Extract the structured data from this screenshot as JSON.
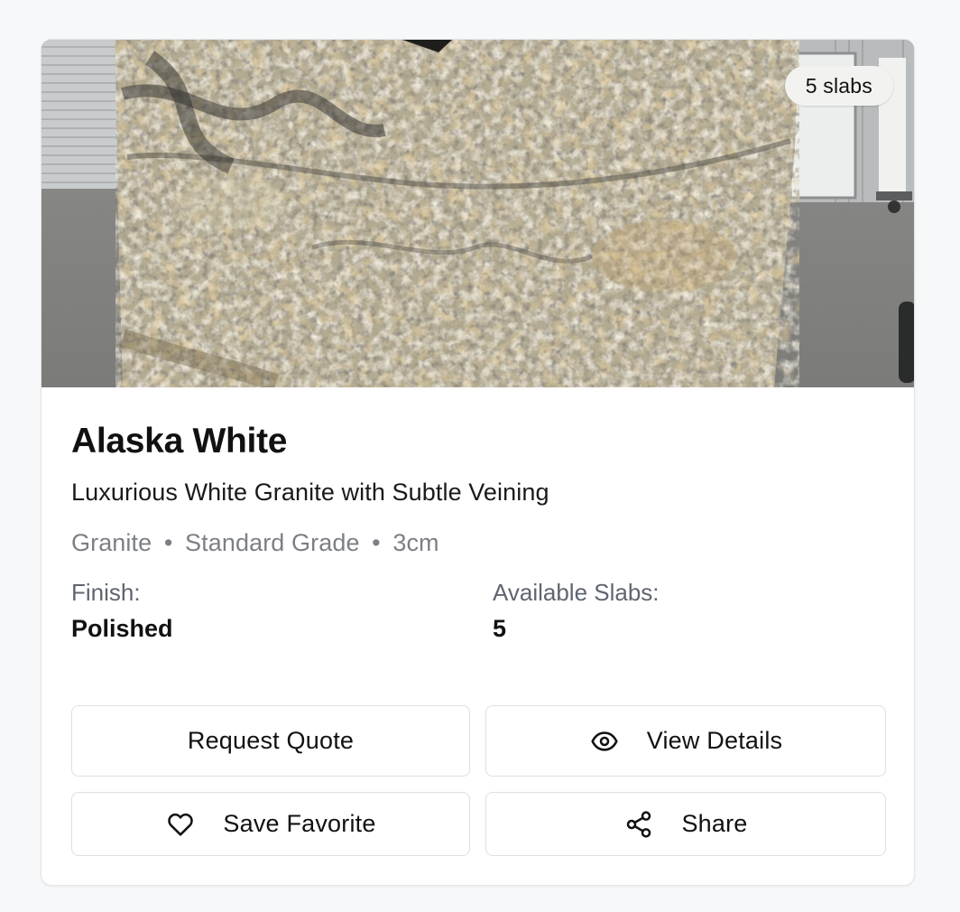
{
  "product": {
    "image_alt": "Alaska White granite slab",
    "slab_badge": "5 slabs",
    "name": "Alaska White",
    "tagline": "Luxurious White Granite with Subtle Veining",
    "material": "Granite",
    "grade": "Standard Grade",
    "thickness": "3cm",
    "separator": "•",
    "finish_label": "Finish:",
    "finish_value": "Polished",
    "available_label": "Available Slabs:",
    "available_value": "5"
  },
  "actions": {
    "request_quote": "Request Quote",
    "view_details": "View Details",
    "save_favorite": "Save Favorite",
    "share": "Share"
  },
  "icons": {
    "view_details": "eye-icon",
    "save_favorite": "heart-icon",
    "share": "share-icon"
  }
}
